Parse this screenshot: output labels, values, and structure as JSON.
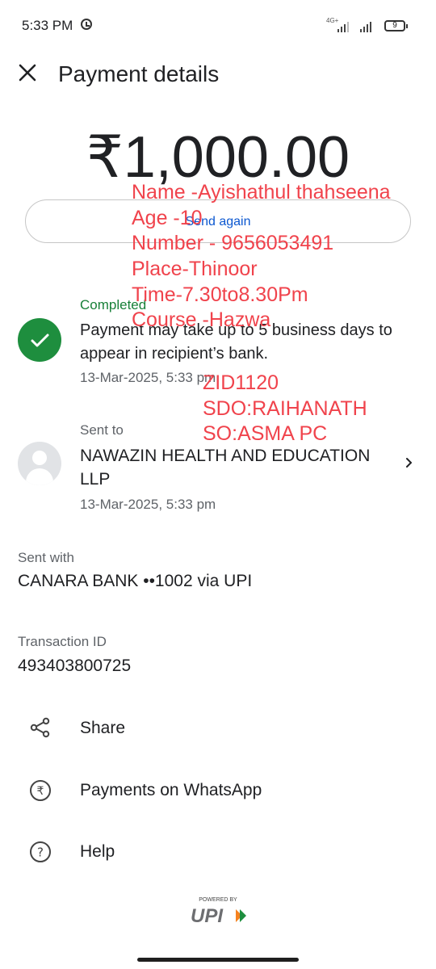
{
  "status_bar": {
    "time": "5:33 PM",
    "network": "4G+",
    "battery": "9"
  },
  "header": {
    "title": "Payment details"
  },
  "payment": {
    "amount": "₹1,000.00",
    "send_again_label": "Send again",
    "status": "Completed",
    "message": "Payment may take up to 5 business days to appear in recipient’s bank.",
    "timestamp": "13-Mar-2025, 5:33 pm"
  },
  "sent_to": {
    "label": "Sent to",
    "name": "NAWAZIN HEALTH AND EDUCATION LLP",
    "timestamp": "13-Mar-2025, 5:33 pm"
  },
  "sent_with": {
    "label": "Sent with",
    "value": "CANARA BANK ••1002 via UPI"
  },
  "transaction": {
    "label": "Transaction ID",
    "value": "493403800725"
  },
  "actions": [
    {
      "label": "Share",
      "icon": "share-icon"
    },
    {
      "label": "Payments on WhatsApp",
      "icon": "rupee-circle-icon"
    },
    {
      "label": "Help",
      "icon": "help-icon"
    }
  ],
  "overlay_note": [
    "Name -Ayishathul thahseena",
    "Age -10",
    "Number - 9656053491",
    "Place-Thinoor",
    "Time-7.30to8.30Pm",
    "Course -Hazwa",
    "ZID1120",
    "SDO:RAIHANATH",
    "SO:ASMA PC"
  ],
  "footer": {
    "powered_by": "POWERED BY",
    "brand": "UPI"
  },
  "colors": {
    "accent_green": "#1e8e3e",
    "link_blue": "#0b57d0",
    "overlay_red": "#f0434c"
  }
}
